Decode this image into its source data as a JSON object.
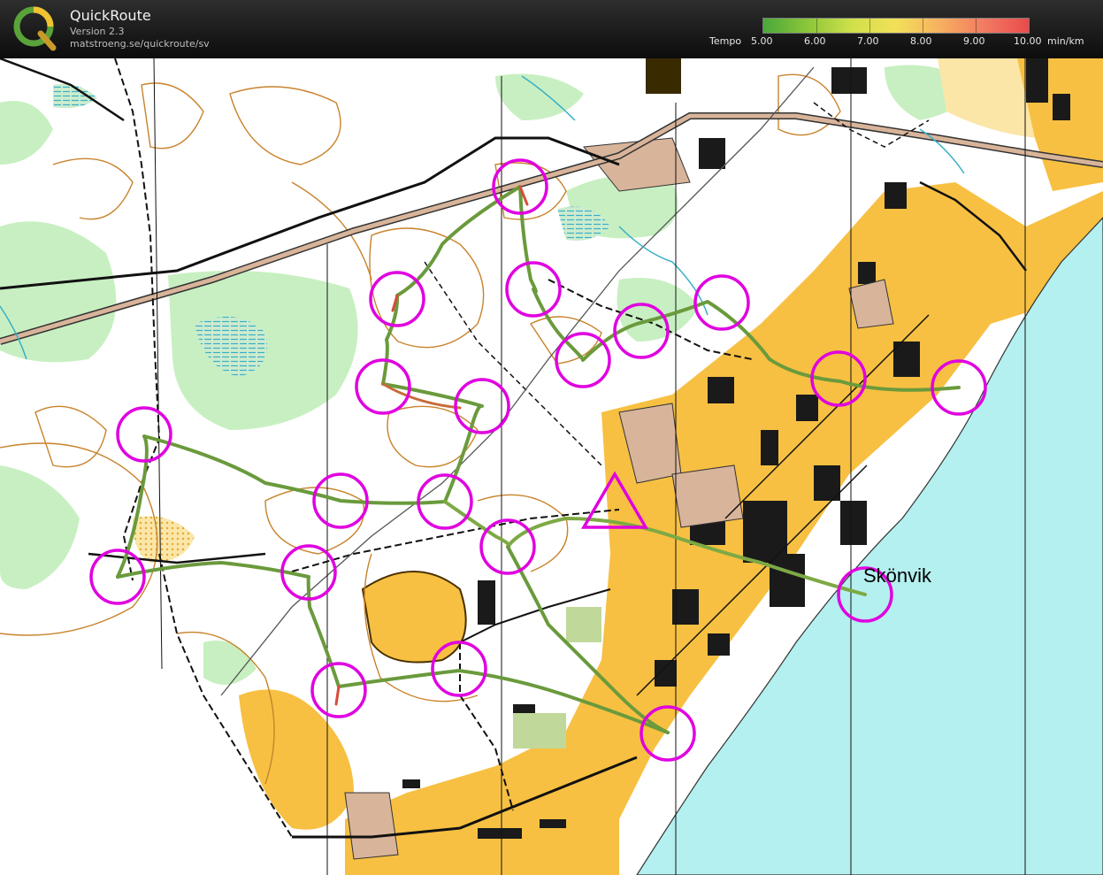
{
  "app": {
    "title": "QuickRoute",
    "version": "Version 2.3",
    "url": "matstroeng.se/quickroute/sv"
  },
  "tempo_legend": {
    "label": "Tempo",
    "values": [
      "5.00",
      "6.00",
      "7.00",
      "8.00",
      "9.00",
      "10.00"
    ],
    "unit": "min/km",
    "color_slow": "#e94b4b",
    "color_fast": "#4aa83a"
  },
  "map": {
    "place_label": "Skönvik",
    "control_color": "#e000e0",
    "water_color": "#b3f0ef",
    "urban_color": "#f7c042"
  }
}
